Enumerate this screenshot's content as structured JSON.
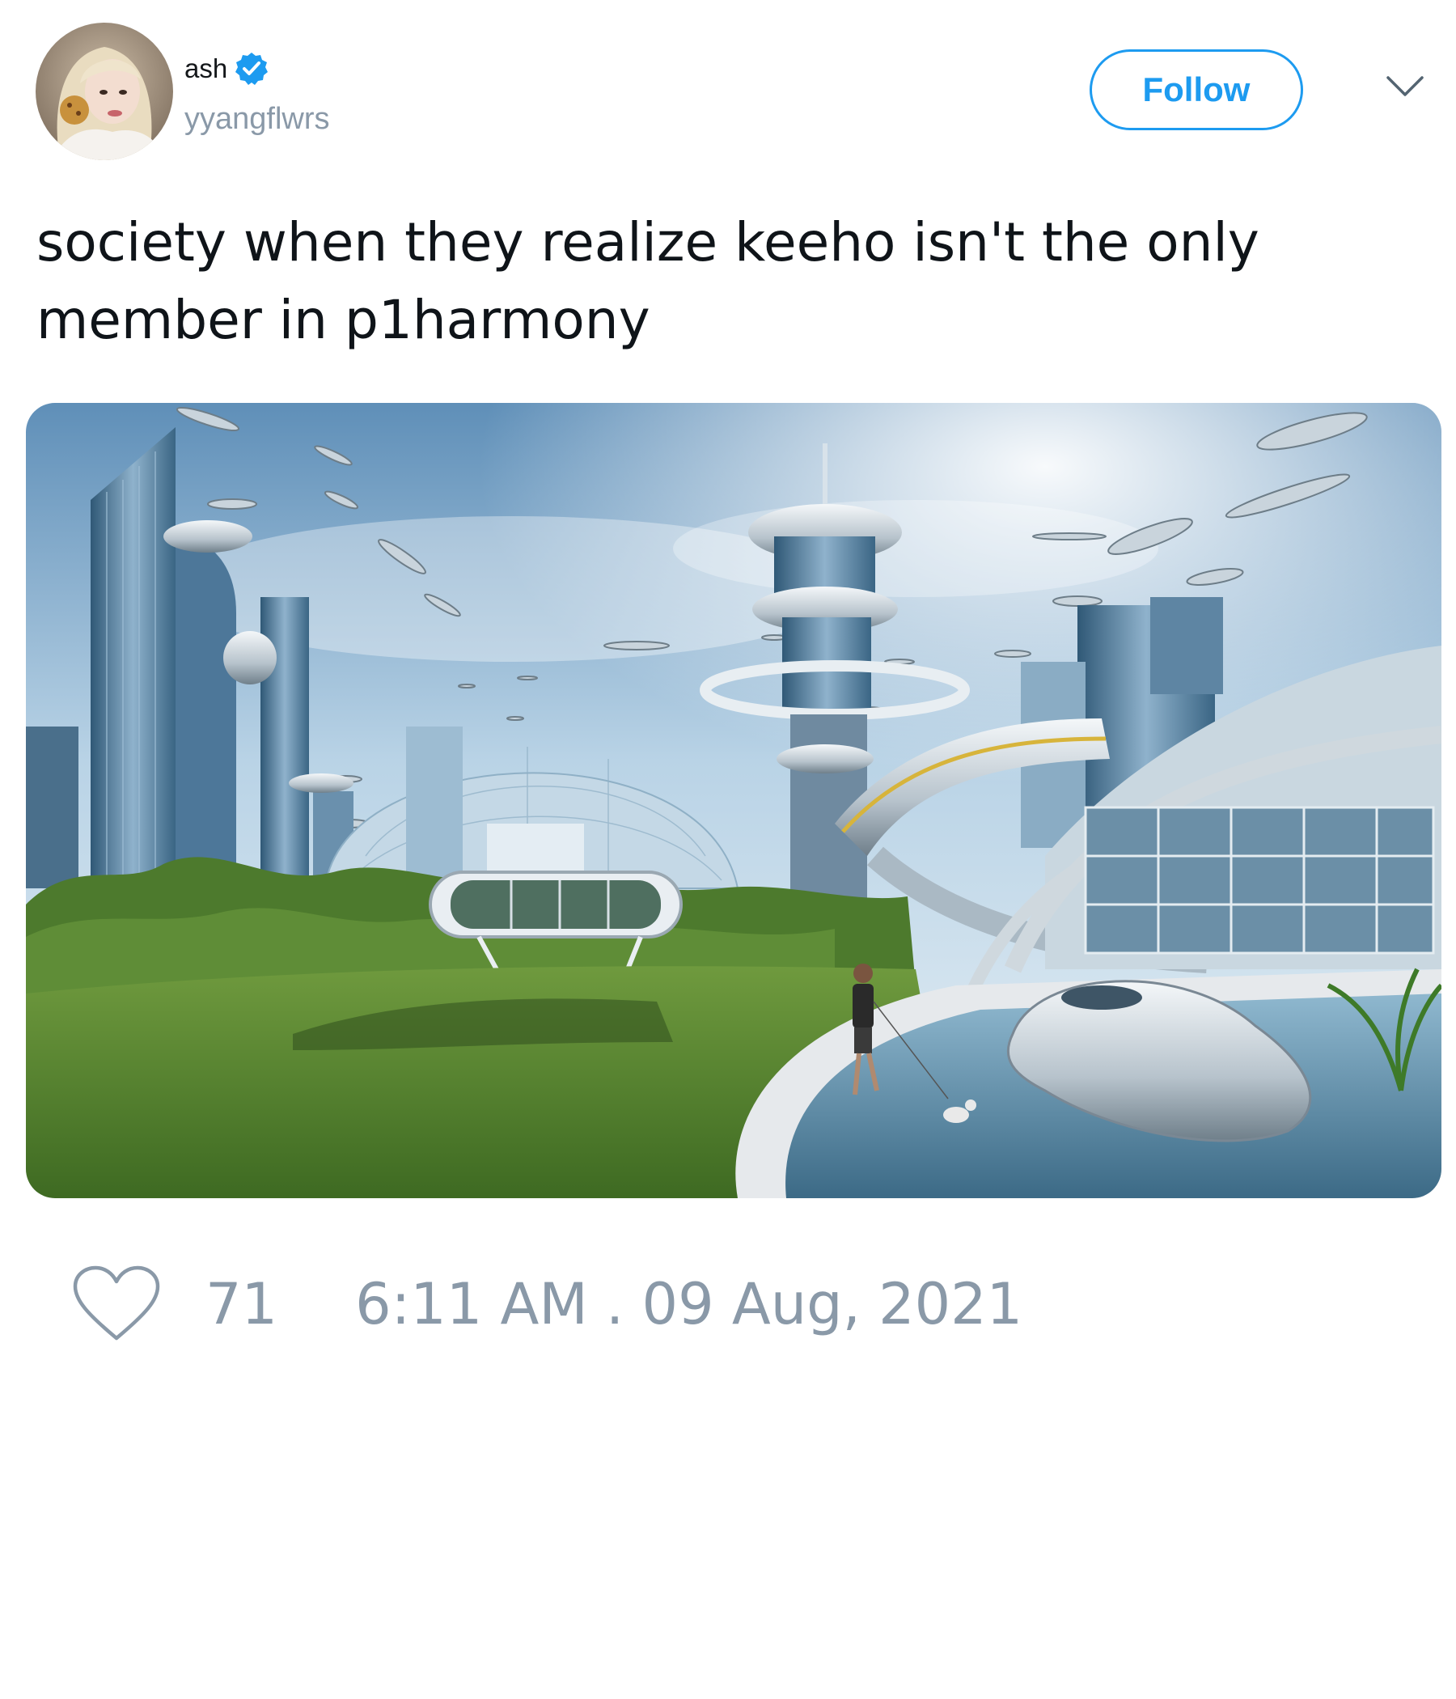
{
  "author": {
    "display_name": "ash",
    "username": "yyangflwrs",
    "verified": true,
    "avatar_icon": "profile-photo-avatar"
  },
  "header": {
    "follow_label": "Follow",
    "menu_icon": "chevron-down-icon"
  },
  "tweet": {
    "text": "society when they realize keeho isn't the only member in p1harmony",
    "media_icon": "futuristic-city-image"
  },
  "footer": {
    "like_icon": "heart-icon",
    "like_count": "71",
    "timestamp": "6:11 AM . 09 Aug, 2021"
  },
  "colors": {
    "accent": "#1d9bf0",
    "muted": "#8a99a8",
    "text": "#0f1419"
  }
}
